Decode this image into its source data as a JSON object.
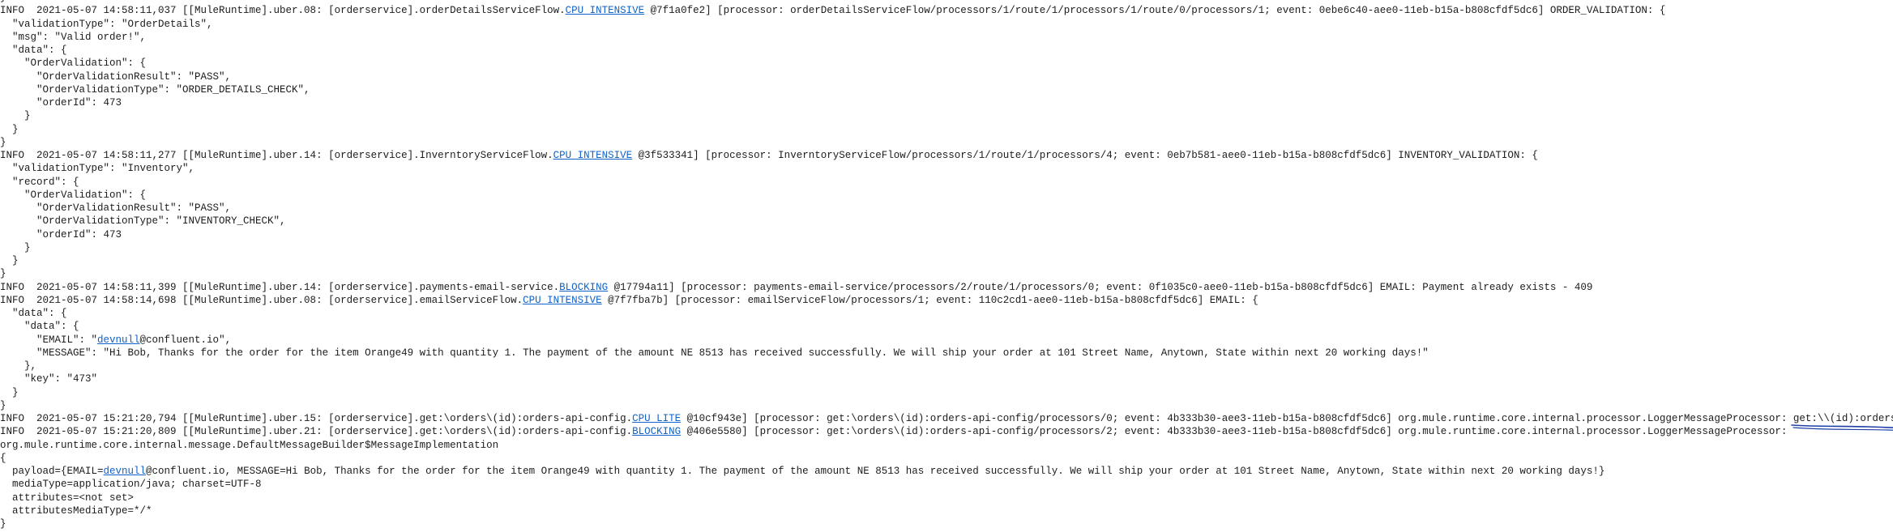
{
  "colors": {
    "background": "#ffffff",
    "text": "#1c1c1c",
    "link": "#0f63c9",
    "ink_annotation": "#1f3fa6"
  },
  "lines": [
    {
      "t": "}"
    },
    {
      "t": "INFO  2021-05-07 14:58:11,037 [[MuleRuntime].uber.08: [orderservice].orderDetailsServiceFlow.",
      "link": "CPU_INTENSIVE",
      "t2": " @7f1a0fe2] [processor: orderDetailsServiceFlow/processors/1/route/1/processors/1/route/0/processors/1; event: 0ebe6c40-aee0-11eb-b15a-b808cfdf5dc6] ORDER_VALIDATION: {"
    },
    {
      "t": "  \"validationType\": \"OrderDetails\","
    },
    {
      "t": "  \"msg\": \"Valid order!\","
    },
    {
      "t": "  \"data\": {"
    },
    {
      "t": "    \"OrderValidation\": {"
    },
    {
      "t": "      \"OrderValidationResult\": \"PASS\","
    },
    {
      "t": "      \"OrderValidationType\": \"ORDER_DETAILS_CHECK\","
    },
    {
      "t": "      \"orderId\": 473"
    },
    {
      "t": "    }"
    },
    {
      "t": "  }"
    },
    {
      "t": "}"
    },
    {
      "t": "INFO  2021-05-07 14:58:11,277 [[MuleRuntime].uber.14: [orderservice].InverntoryServiceFlow.",
      "link": "CPU_INTENSIVE",
      "t2": " @3f533341] [processor: InverntoryServiceFlow/processors/1/route/1/processors/4; event: 0eb7b581-aee0-11eb-b15a-b808cfdf5dc6] INVENTORY_VALIDATION: {"
    },
    {
      "t": "  \"validationType\": \"Inventory\","
    },
    {
      "t": "  \"record\": {"
    },
    {
      "t": "    \"OrderValidation\": {"
    },
    {
      "t": "      \"OrderValidationResult\": \"PASS\","
    },
    {
      "t": "      \"OrderValidationType\": \"INVENTORY_CHECK\","
    },
    {
      "t": "      \"orderId\": 473"
    },
    {
      "t": "    }"
    },
    {
      "t": "  }"
    },
    {
      "t": "}"
    },
    {
      "t": "INFO  2021-05-07 14:58:11,399 [[MuleRuntime].uber.14: [orderservice].payments-email-service.",
      "link": "BLOCKING",
      "t2": " @17794a11] [processor: payments-email-service/processors/2/route/1/processors/0; event: 0f1035c0-aee0-11eb-b15a-b808cfdf5dc6] EMAIL: Payment already exists - 409"
    },
    {
      "t": "INFO  2021-05-07 14:58:14,698 [[MuleRuntime].uber.08: [orderservice].emailServiceFlow.",
      "link": "CPU_INTENSIVE",
      "t2": " @7f7fba7b] [processor: emailServiceFlow/processors/1; event: 110c2cd1-aee0-11eb-b15a-b808cfdf5dc6] EMAIL: {"
    },
    {
      "t": "  \"data\": {"
    },
    {
      "t": "    \"data\": {"
    },
    {
      "t": "      \"EMAIL\": \"",
      "link": "devnull",
      "t2": "@confluent.io\","
    },
    {
      "t": "      \"MESSAGE\": \"Hi Bob, Thanks for the order for the item Orange49 with quantity 1. The payment of the amount NE 8513 has received successfully. We will ship your order at 101 Street Name, Anytown, State within next 20 working days!\""
    },
    {
      "t": "    },"
    },
    {
      "t": "    \"key\": \"473\""
    },
    {
      "t": "  }"
    },
    {
      "t": "}"
    },
    {
      "t": "INFO  2021-05-07 15:21:20,794 [[MuleRuntime].uber.15: [orderservice].get:\\orders\\(id):orders-api-config.",
      "link": "CPU_LITE",
      "t2": " @10cf943e] [processor: get:\\orders\\(id):orders-api-config/processors/0; event: 4b333b30-aee3-11eb-b15a-b808cfdf5dc6] org.mule.runtime.core.internal.processor.LoggerMessageProcessor: ",
      "annotated": "get:\\\\(id):orders-api-config"
    },
    {
      "t": "INFO  2021-05-07 15:21:20,809 [[MuleRuntime].uber.21: [orderservice].get:\\orders\\(id):orders-api-config.",
      "link": "BLOCKING",
      "t2": " @406e5580] [processor: get:\\orders\\(id):orders-api-config/processors/2; event: 4b333b30-aee3-11eb-b15a-b808cfdf5dc6] org.mule.runtime.core.internal.processor.LoggerMessageProcessor:"
    },
    {
      "t": "org.mule.runtime.core.internal.message.DefaultMessageBuilder$MessageImplementation"
    },
    {
      "t": "{"
    },
    {
      "t": "  payload={EMAIL=",
      "link": "devnull",
      "t2": "@confluent.io, MESSAGE=Hi Bob, Thanks for the order for the item Orange49 with quantity 1. The payment of the amount NE 8513 has received successfully. We will ship your order at 101 Street Name, Anytown, State within next 20 working days!}"
    },
    {
      "t": "  mediaType=application/java; charset=UTF-8"
    },
    {
      "t": "  attributes=<not set>"
    },
    {
      "t": "  attributesMediaType=*/*"
    },
    {
      "t": "}"
    }
  ]
}
